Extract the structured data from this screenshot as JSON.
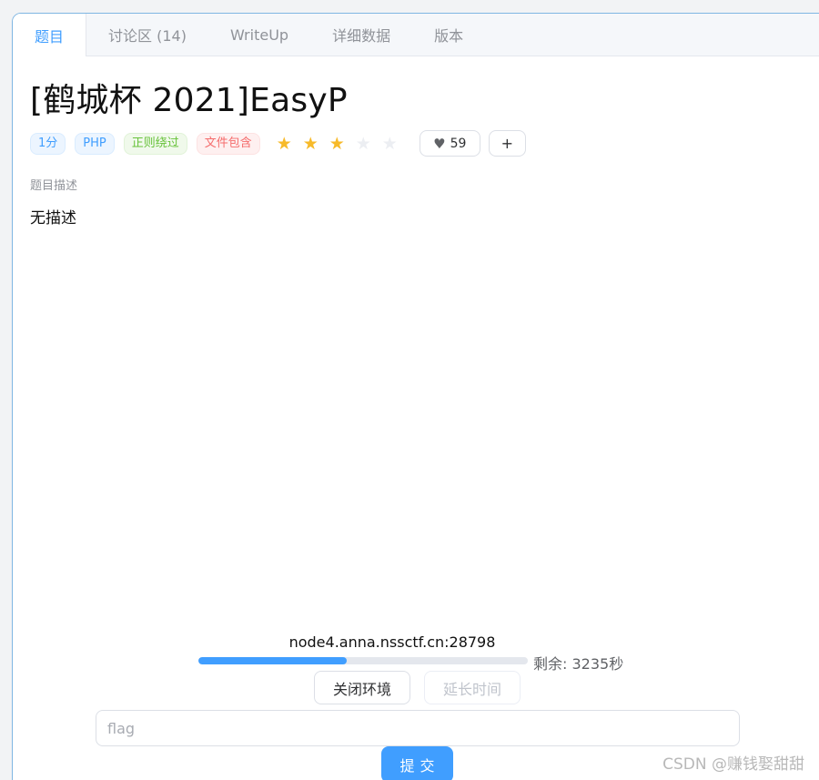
{
  "tabs": [
    {
      "label": "题目"
    },
    {
      "label": "讨论区 (14)"
    },
    {
      "label": "WriteUp"
    },
    {
      "label": "详细数据"
    },
    {
      "label": "版本"
    }
  ],
  "problem": {
    "title": "[鹤城杯 2021]EasyP",
    "tags": {
      "score": "1分",
      "lang": "PHP",
      "cat1": "正则绕过",
      "cat2": "文件包含"
    },
    "difficulty": {
      "rating": 3,
      "max": 5
    },
    "likes": "59",
    "plus_label": "+",
    "desc_label": "题目描述",
    "desc_text": "无描述"
  },
  "env": {
    "address": "node4.anna.nssctf.cn:28798",
    "progress_fraction": 0.45,
    "remaining": "剩余: 3235秒",
    "close_label": "关闭环境",
    "extend_label": "延长时间"
  },
  "flag": {
    "placeholder": "flag",
    "submit_label": "提交"
  },
  "watermark": "CSDN @赚钱娶甜甜",
  "colors": {
    "accent": "#409eff",
    "star": "#f7ba2a"
  },
  "icons": {
    "like": "heart-icon",
    "star": "star-icon"
  }
}
